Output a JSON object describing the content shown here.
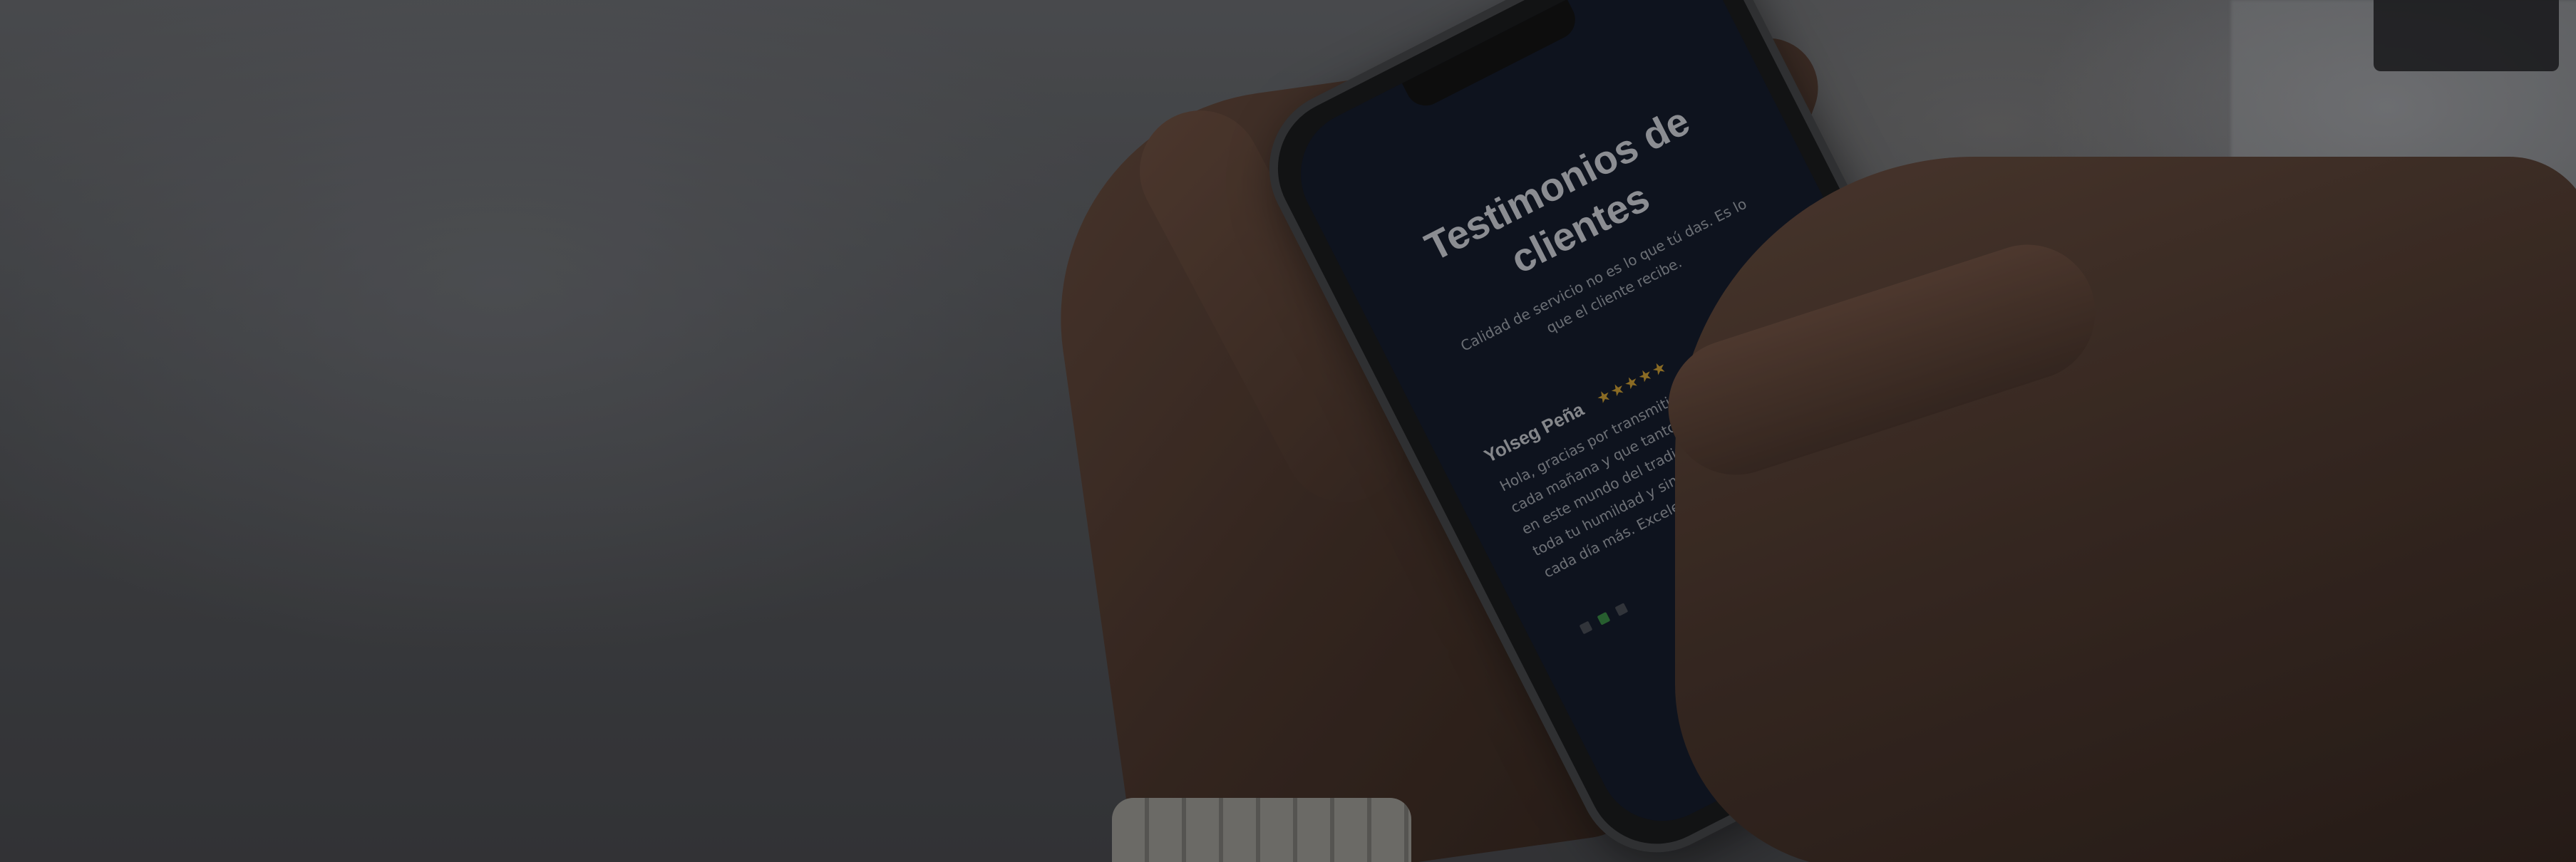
{
  "phone_screen": {
    "heading": "Testimonios de clientes",
    "subheading": "Calidad de servicio no es lo que tú das. Es lo que el cliente recibe.",
    "testimonial": {
      "author": "Yolseg Peña",
      "stars": "★★★★★",
      "rating": 5,
      "text": "Hola, gracias por transmitir esas energías positivas cada mañana y que tanto me han ayudado a crecer en este mundo del trading. Eres la mejor, admiro toda tu humildad y sinceridad. Te admiro y quiero ti cada día más. Excelente!!"
    },
    "carousel": {
      "total": 3,
      "active_index": 2
    }
  },
  "colors": {
    "screen_bg": "#0c1222",
    "star_color": "#b78d2a",
    "active_dot": "#2f7a3a"
  }
}
